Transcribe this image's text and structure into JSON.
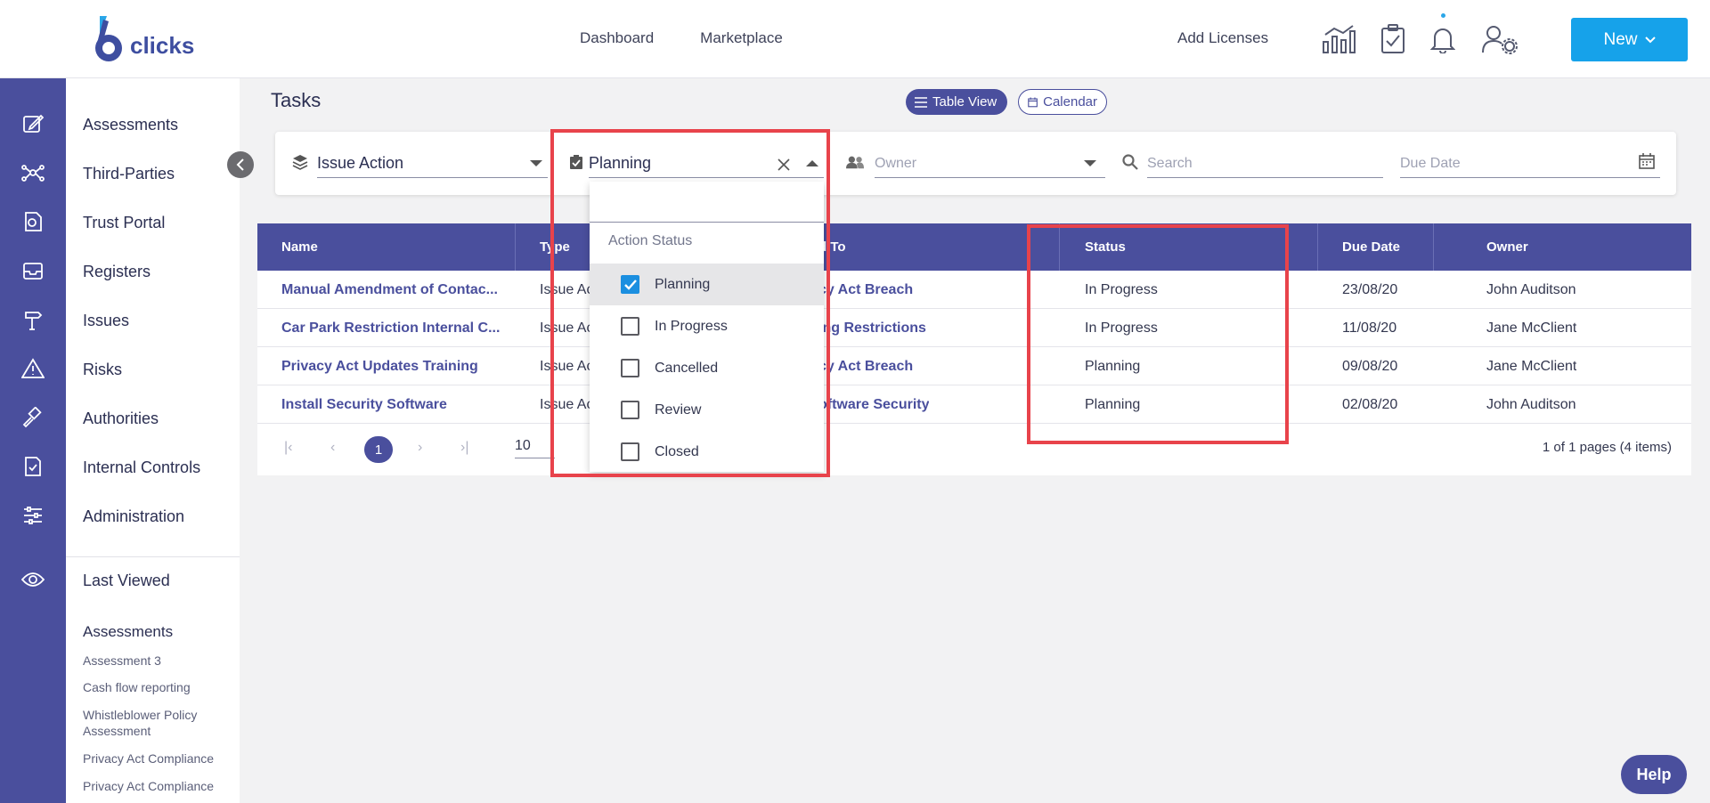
{
  "brand": {
    "logo_text": "clicks",
    "accent": "#4a4f9d",
    "primary_button": "#16a2ea"
  },
  "topnav": {
    "items": [
      "Dashboard",
      "Marketplace"
    ],
    "add_licenses": "Add Licenses",
    "new_label": "New"
  },
  "sidebar": {
    "items": [
      "Assessments",
      "Third-Parties",
      "Trust Portal",
      "Registers",
      "Issues",
      "Risks",
      "Authorities",
      "Internal Controls",
      "Administration"
    ],
    "last_viewed": "Last Viewed",
    "recent_group": "Assessments",
    "recent_items": [
      "Assessment 3",
      "Cash flow reporting",
      "Whistleblower Policy Assessment",
      "Privacy Act Compliance",
      "Privacy Act Compliance"
    ]
  },
  "page": {
    "title": "Tasks",
    "table_view": "Table View",
    "calendar": "Calendar"
  },
  "filters": {
    "type_value": "Issue Action",
    "status_value": "Planning",
    "owner_placeholder": "Owner",
    "search_placeholder": "Search",
    "due_date_placeholder": "Due Date"
  },
  "table": {
    "headers": [
      "Name",
      "Type",
      "Linked To",
      "Status",
      "Due Date",
      "Owner"
    ],
    "headers_visible": {
      "type": "Type",
      "linked": "d To"
    },
    "rows": [
      {
        "name": "Manual Amendment of Contac...",
        "type": "Issue Ac",
        "linked": "cy Act Breach",
        "status": "In Progress",
        "due": "23/08/20",
        "owner": "John Auditson"
      },
      {
        "name": "Car Park Restriction Internal C...",
        "type": "Issue Ac",
        "linked": "ing Restrictions",
        "status": "In Progress",
        "due": "11/08/20",
        "owner": "Jane McClient"
      },
      {
        "name": "Privacy Act Updates Training",
        "type": "Issue Ac",
        "linked": "cy Act Breach",
        "status": "Planning",
        "due": "09/08/20",
        "owner": "Jane McClient"
      },
      {
        "name": "Install Security Software",
        "type": "Issue Ac",
        "linked": "oftware Security",
        "status": "Planning",
        "due": "02/08/20",
        "owner": "John Auditson"
      }
    ],
    "pager": {
      "current_page": "1",
      "page_size": "10",
      "info": "1 of 1 pages (4 items)"
    }
  },
  "dropdown": {
    "header": "Action Status",
    "options": [
      {
        "label": "Planning",
        "checked": true
      },
      {
        "label": "In Progress",
        "checked": false
      },
      {
        "label": "Cancelled",
        "checked": false
      },
      {
        "label": "Review",
        "checked": false
      },
      {
        "label": "Closed",
        "checked": false
      }
    ]
  },
  "help": {
    "label": "Help"
  },
  "highlight_color": "#e8434b"
}
